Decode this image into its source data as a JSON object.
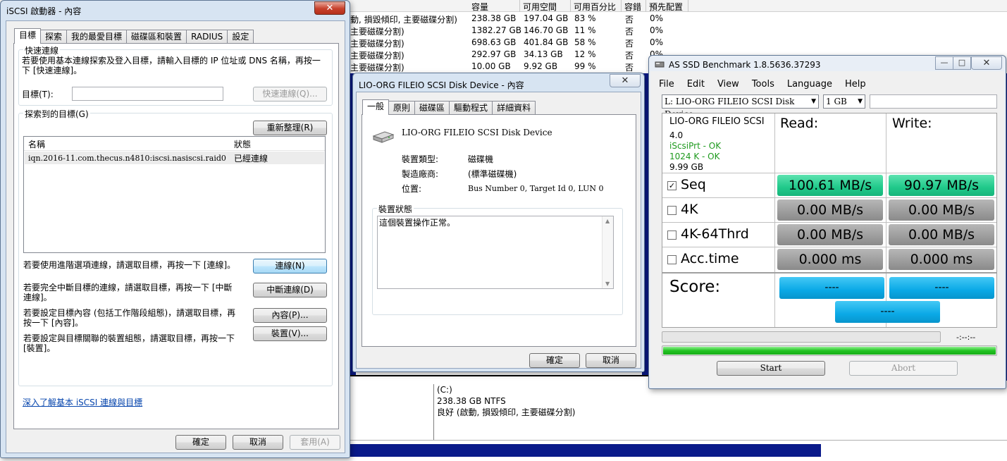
{
  "disk_mgmt": {
    "columns": [
      "容量",
      "可用空間",
      "可用百分比",
      "容錯",
      "預先配置"
    ],
    "rows": [
      {
        "status": "動, 損毀傾印, 主要磁碟分割)",
        "capacity": "238.38 GB",
        "free": "197.04 GB",
        "pct": "83 %",
        "fault": "否",
        "overhead": "0%"
      },
      {
        "status": "主要磁碟分割)",
        "capacity": "1382.27 GB",
        "free": "146.70 GB",
        "pct": "11 %",
        "fault": "否",
        "overhead": "0%"
      },
      {
        "status": "主要磁碟分割)",
        "capacity": "698.63 GB",
        "free": "401.84 GB",
        "pct": "58 %",
        "fault": "否",
        "overhead": "0%"
      },
      {
        "status": "主要磁碟分割)",
        "capacity": "292.97 GB",
        "free": "34.13 GB",
        "pct": "12 %",
        "fault": "否",
        "overhead": "0%"
      },
      {
        "status": "主要磁碟分割)",
        "capacity": "10.00 GB",
        "free": "9.92 GB",
        "pct": "99 %",
        "fault": "否",
        "overhead": "0%"
      }
    ],
    "partition": {
      "name": "(C:)",
      "size": "238.38 GB NTFS",
      "status": "良好 (啟動, 損毀傾印, 主要磁碟分割)"
    }
  },
  "iscsi": {
    "title": "iSCSI 啟動器 - 內容",
    "close": "✕",
    "tabs": [
      "目標",
      "探索",
      "我的最愛目標",
      "磁碟區和裝置",
      "RADIUS",
      "設定"
    ],
    "quick_connect": {
      "label": "快速連線",
      "desc": "若要使用基本連線探索及登入目標，請輸入目標的 IP 位址或 DNS 名稱，再按一下 [快速連線]。",
      "target_label": "目標(T):",
      "target_value": "",
      "button": "快速連線(Q)..."
    },
    "discovered": {
      "label": "探索到的目標(G)",
      "refresh": "重新整理(R)",
      "col_name": "名稱",
      "col_status": "狀態",
      "rows": [
        {
          "name": "iqn.2016-11.com.thecus.n4810:iscsi.nasiscsi.raid0",
          "status": "已經連線"
        }
      ]
    },
    "actions": [
      {
        "desc": "若要使用進階選項連線，請選取目標，再按一下 [連線]。",
        "button": "連線(N)"
      },
      {
        "desc": "若要完全中斷目標的連線，請選取目標，再按一下 [中斷連線]。",
        "button": "中斷連線(D)"
      },
      {
        "desc": "若要設定目標內容 (包括工作階段組態)，請選取目標，再按一下 [內容]。",
        "button": "內容(P)..."
      },
      {
        "desc": "若要設定與目標關聯的裝置組態，請選取目標，再按一下 [裝置]。",
        "button": "裝置(V)..."
      }
    ],
    "link": "深入了解基本 iSCSI 連線與目標",
    "ok": "確定",
    "cancel": "取消",
    "apply": "套用(A)"
  },
  "device": {
    "title": "LIO-ORG FILEIO SCSI Disk Device - 內容",
    "close": "✕",
    "tabs": [
      "一般",
      "原則",
      "磁碟區",
      "驅動程式",
      "詳細資料"
    ],
    "name": "LIO-ORG FILEIO SCSI Disk Device",
    "type_label": "裝置類型:",
    "type_value": "磁碟機",
    "mfr_label": "製造廠商:",
    "mfr_value": "(標準磁碟機)",
    "loc_label": "位置:",
    "loc_value": "Bus Number 0, Target Id 0, LUN 0",
    "status_label": "裝置狀態",
    "status_text": "這個裝置操作正常。",
    "ok": "確定",
    "cancel": "取消"
  },
  "asssd": {
    "title": "AS SSD Benchmark 1.8.5636.37293",
    "menu": [
      "File",
      "Edit",
      "View",
      "Tools",
      "Language",
      "Help"
    ],
    "drive": "L: LIO-ORG FILEIO SCSI Disk Device",
    "size": "1 GB",
    "info": {
      "name": "LIO-ORG FILEIO SCSI",
      "ver": "4.0",
      "driver": "iScsiPrt - OK",
      "align": "1024 K - OK",
      "capacity": "9.99 GB"
    },
    "read_header": "Read:",
    "write_header": "Write:",
    "tests": [
      {
        "label": "Seq",
        "checked": true,
        "read": "100.61 MB/s",
        "write": "90.97 MB/s"
      },
      {
        "label": "4K",
        "checked": false,
        "read": "0.00 MB/s",
        "write": "0.00 MB/s"
      },
      {
        "label": "4K-64Thrd",
        "checked": false,
        "read": "0.00 MB/s",
        "write": "0.00 MB/s"
      },
      {
        "label": "Acc.time",
        "checked": false,
        "read": "0.000 ms",
        "write": "0.000 ms"
      }
    ],
    "score_label": "Score:",
    "score_read": "----",
    "score_write": "----",
    "score_total": "----",
    "time": "-:--:--",
    "progress_top": 0,
    "progress_bottom": 1.0,
    "start": "Start",
    "abort": "Abort",
    "check_mark": "✓",
    "min": "—",
    "max": "□",
    "close": "✕"
  }
}
